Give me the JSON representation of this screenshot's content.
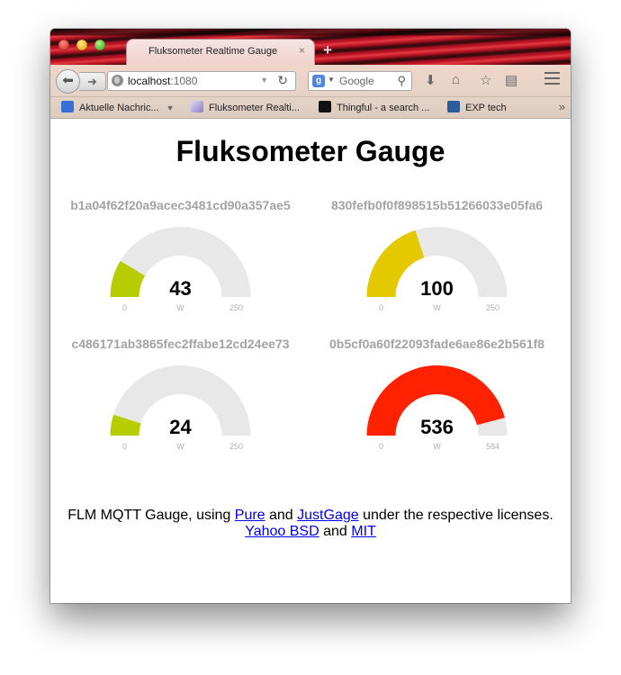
{
  "window": {
    "tab_title": "Fluksometer Realtime Gauge",
    "new_tab_symbol": "+",
    "close_symbol": "×"
  },
  "navbar": {
    "url_host": "localhost",
    "url_port": ":1080",
    "search_engine": "Google",
    "search_placeholder": "Google"
  },
  "bookmarks": [
    {
      "label": "Aktuelle Nachric...",
      "icon": "rss-icon",
      "color": "#3a6fd8"
    },
    {
      "label": "Fluksometer Realti...",
      "icon": "chart-icon",
      "color": "#8a7cc4"
    },
    {
      "label": "Thingful - a search ...",
      "icon": "thingful-icon",
      "color": "#111111"
    },
    {
      "label": "EXP tech",
      "icon": "exp-icon",
      "color": "#2a5b9a"
    }
  ],
  "page": {
    "title": "Fluksometer Gauge"
  },
  "gauges": [
    {
      "id": "b1a04f62f20a9acec3481cd90a357ae5",
      "value": 43,
      "min": 0,
      "max": 250,
      "unit": "W",
      "color": "#b8cd00"
    },
    {
      "id": "830fefb0f0f898515b51266033e05fa6",
      "value": 100,
      "min": 0,
      "max": 250,
      "unit": "W",
      "color": "#e4c800"
    },
    {
      "id": "c486171ab3865fec2ffabe12cd24ee73",
      "value": 24,
      "min": 0,
      "max": 250,
      "unit": "W",
      "color": "#b8cd00"
    },
    {
      "id": "0b5cf0a60f22093fade6ae86e2b561f8",
      "value": 536,
      "min": 0,
      "max": 584,
      "unit": "W",
      "color": "#ff2200"
    }
  ],
  "footer": {
    "text_1": "FLM MQTT Gauge, using ",
    "link_pure": "Pure",
    "text_2": " and ",
    "link_justgage": "JustGage",
    "text_3": " under the respective licenses.",
    "link_bsd": "Yahoo BSD",
    "text_4": " and ",
    "link_mit": "MIT"
  }
}
